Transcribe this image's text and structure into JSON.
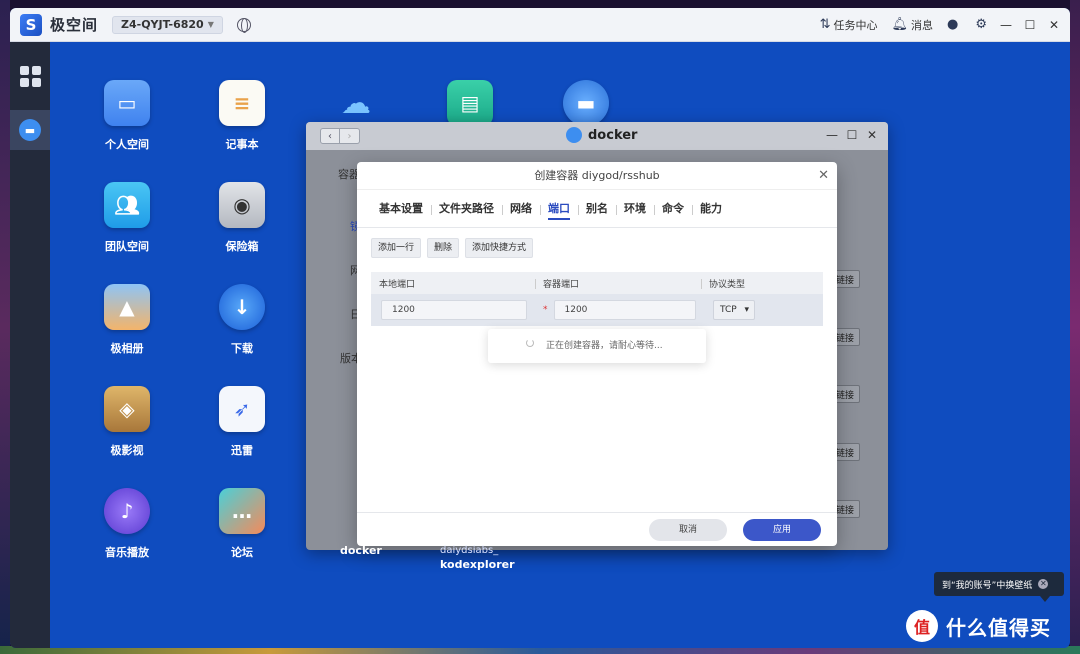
{
  "topbar": {
    "brand": "极空间",
    "device": "Z4-QYJT-6820",
    "task_center": "任务中心",
    "messages": "消息"
  },
  "desktop_apps": [
    {
      "label": "个人空间",
      "icon": "folder-icon",
      "color": "#4a8ff5"
    },
    {
      "label": "记事本",
      "icon": "notepad-icon",
      "color": "#f5f5f0"
    },
    {
      "label": "团队空间",
      "icon": "team-folder-icon",
      "color": "#2ab0f0"
    },
    {
      "label": "保险箱",
      "icon": "safe-icon",
      "color": "#c8cbd0"
    },
    {
      "label": "极相册",
      "icon": "photos-icon",
      "color": "#f0a84a"
    },
    {
      "label": "下载",
      "icon": "download-icon",
      "color": "#2a7ee8"
    },
    {
      "label": "极影视",
      "icon": "video-icon",
      "color": "#c89a4a"
    },
    {
      "label": "迅雷",
      "icon": "thunder-icon",
      "color": "#f0f4fa"
    },
    {
      "label": "音乐播放",
      "icon": "music-icon",
      "color": "#7a5af0"
    },
    {
      "label": "论坛",
      "icon": "forum-icon",
      "color": "#2ac0c8"
    }
  ],
  "docker_window": {
    "title": "docker",
    "side_label": "容器",
    "link_label": "链接",
    "bottom_label": "docker",
    "side_labels": [
      "镜",
      "网",
      "日",
      "版本"
    ]
  },
  "bottom_labels": {
    "kodex_top": "daiydsiabs_",
    "kodex": "kodexplorer"
  },
  "modal": {
    "title": "创建容器 diygod/rsshub",
    "tabs": [
      "基本设置",
      "文件夹路径",
      "网络",
      "端口",
      "别名",
      "环境",
      "命令",
      "能力"
    ],
    "active_tab": "端口",
    "toolbar": [
      "添加一行",
      "删除",
      "添加快捷方式"
    ],
    "table_headers": [
      "本地端口",
      "容器端口",
      "协议类型"
    ],
    "row": {
      "local_port": "1200",
      "container_port": "1200",
      "protocol": "TCP"
    },
    "loading_text": "正在创建容器，请耐心等待...",
    "cancel": "取消",
    "apply": "应用"
  },
  "tip": "到“我的账号”中换壁纸",
  "watermark": "什么值得买",
  "watermark_logo": "值"
}
